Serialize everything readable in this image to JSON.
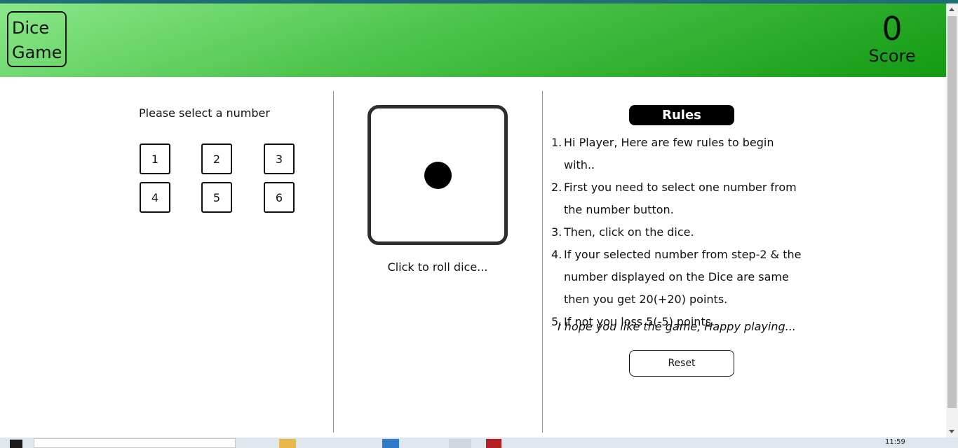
{
  "header": {
    "logo_line1": "Dice",
    "logo_line2": "Game",
    "score_value": "0",
    "score_label": "Score"
  },
  "selector": {
    "title": "Please select a number",
    "numbers": [
      "1",
      "2",
      "3",
      "4",
      "5",
      "6"
    ]
  },
  "dice": {
    "face_value": 1,
    "hint": "Click to roll dice..."
  },
  "rules": {
    "title": "Rules",
    "items": [
      {
        "num": "1.",
        "text": "Hi Player, Here are few rules to begin with.."
      },
      {
        "num": "2.",
        "text": "First you need to select one number from the number button."
      },
      {
        "num": "3.",
        "text": "Then, click on the dice."
      },
      {
        "num": "4.",
        "text": "If your selected number from step-2 & the number displayed on the Dice are same then you get 20(+20) points."
      },
      {
        "num": "5.",
        "text": "If not you loss 5(-5) points."
      }
    ],
    "closing": "I hope you like the game, Happy playing...",
    "reset_label": "Reset"
  },
  "taskbar": {
    "time": "11:59"
  },
  "colors": {
    "header_light": "#8be88a",
    "header_dark": "#139a12",
    "dice_border": "#2d2d2d"
  }
}
